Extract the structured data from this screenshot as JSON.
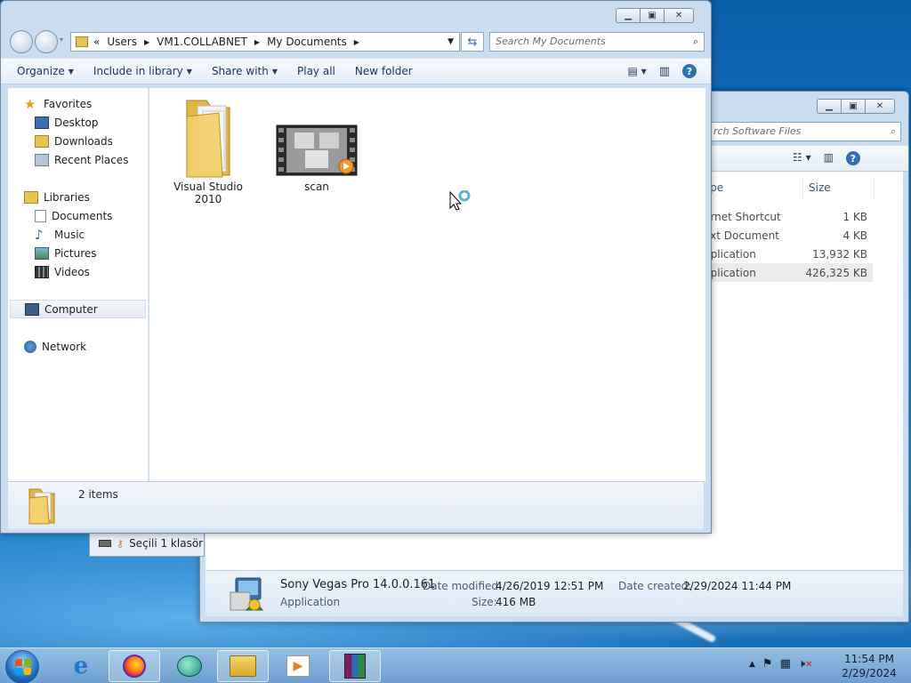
{
  "front_window": {
    "address": {
      "overflow": "«",
      "crumbs": [
        "Users",
        "VM1.COLLABNET",
        "My Documents"
      ]
    },
    "search_placeholder": "Search My Documents",
    "toolbar": {
      "organize": "Organize",
      "include_in_library": "Include in library",
      "share_with": "Share with",
      "play_all": "Play all",
      "new_folder": "New folder"
    },
    "nav": {
      "favorites": "Favorites",
      "desktop": "Desktop",
      "downloads": "Downloads",
      "recent_places": "Recent Places",
      "libraries": "Libraries",
      "documents": "Documents",
      "music": "Music",
      "pictures": "Pictures",
      "videos": "Videos",
      "computer": "Computer",
      "network": "Network"
    },
    "items": [
      {
        "name": "Visual Studio 2010",
        "icon": "folder-icon"
      },
      {
        "name": "scan",
        "icon": "video-file-icon"
      }
    ],
    "status": "2 items"
  },
  "back_window": {
    "search_placeholder": "rch Software Files",
    "columns": {
      "type": "ype",
      "size": "Size"
    },
    "rows": [
      {
        "type": "ernet Shortcut",
        "size": "1 KB"
      },
      {
        "type": "ext Document",
        "size": "4 KB"
      },
      {
        "type": "pplication",
        "size": "13,932 KB"
      },
      {
        "type": "pplication",
        "size": "426,325 KB"
      }
    ],
    "details": {
      "name": "Sony Vegas Pro 14.0.0.161",
      "kind": "Application",
      "date_modified_label": "Date modified:",
      "date_modified": "4/26/2019 12:51 PM",
      "size_label": "Size:",
      "size": "416 MB",
      "date_created_label": "Date created:",
      "date_created": "2/29/2024 11:44 PM"
    }
  },
  "third_window": {
    "status": "Seçili 1 klasör"
  },
  "taskbar": {
    "time": "11:54 PM",
    "date": "2/29/2024"
  },
  "colors": {
    "selection": "#ececec",
    "link_blue": "#2f6fb3",
    "chrome": "#c9dcf0"
  }
}
